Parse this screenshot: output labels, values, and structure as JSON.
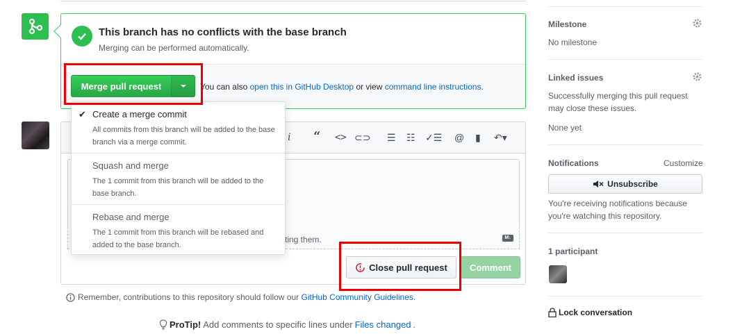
{
  "merge": {
    "status_title": "This branch has no conflicts with the base branch",
    "status_sub": "Merging can be performed automatically.",
    "merge_button": "Merge pull request",
    "also_prefix": "You can also ",
    "desktop_link": "open this in GitHub Desktop",
    "also_mid": " or view ",
    "cli_link": "command line instructions",
    "also_suffix": "."
  },
  "dropdown": {
    "items": [
      {
        "title": "Create a merge commit",
        "desc": "All commits from this branch will be added to the base branch via a merge commit.",
        "selected": true
      },
      {
        "title": "Squash and merge",
        "desc": "The 1 commit from this branch will be added to the base branch.",
        "selected": false
      },
      {
        "title": "Rebase and merge",
        "desc": "The 1 commit from this branch will be rebased and added to the base branch.",
        "selected": false
      }
    ]
  },
  "comment": {
    "attach_text_partial": "ting them.",
    "md_badge": "M↓",
    "close_button": "Close pull request",
    "comment_button": "Comment"
  },
  "footer": {
    "guidelines_prefix": "Remember, contributions to this repository should follow our ",
    "guidelines_link": "GitHub Community Guidelines",
    "guidelines_suffix": ".",
    "protip_label": "ProTip!",
    "protip_text": " Add comments to specific lines under ",
    "protip_link": "Files changed",
    "protip_suffix": "."
  },
  "sidebar": {
    "milestone_heading": "Milestone",
    "milestone_value": "No milestone",
    "linked_heading": "Linked issues",
    "linked_desc": "Successfully merging this pull request may close these issues.",
    "linked_value": "None yet",
    "notifications_heading": "Notifications",
    "customize_link": "Customize",
    "unsubscribe_button": "Unsubscribe",
    "notif_desc": "You're receiving notifications because you're watching this repository.",
    "participants_heading": "1 participant",
    "lock_label": "Lock conversation"
  },
  "colors": {
    "success_green": "#2cbe4e",
    "highlight_red": "#ee0000",
    "link_blue": "#0366d6"
  }
}
